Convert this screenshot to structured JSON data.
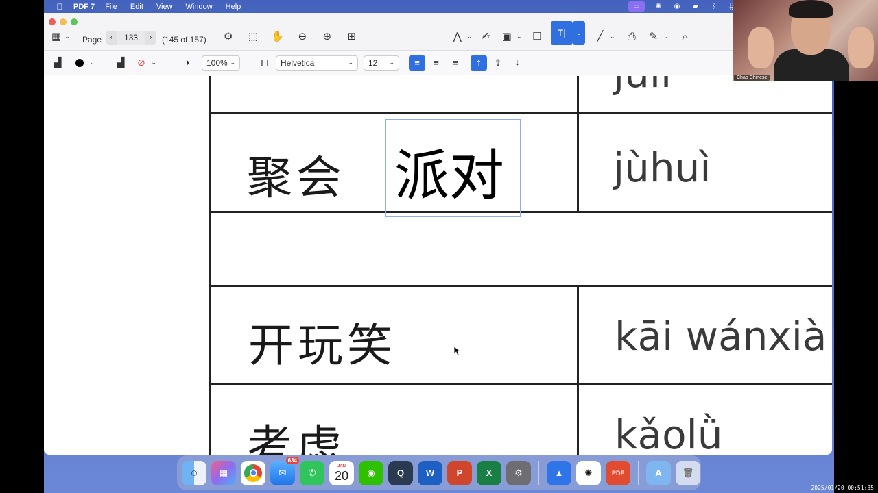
{
  "menubar": {
    "app_name": "PDF 7",
    "items": [
      "File",
      "Edit",
      "View",
      "Window",
      "Help"
    ]
  },
  "toolbar": {
    "page_label": "Page",
    "page_number": "133",
    "page_count": "(145 of 157)"
  },
  "format_bar": {
    "zoom": "100%",
    "font": "Helvetica",
    "font_size": "12"
  },
  "document": {
    "rows": [
      {
        "chinese": "聚会",
        "pinyin": "jùhuì",
        "note": "派对"
      },
      {
        "chinese": "开玩笑",
        "pinyin": "kāi wánxià"
      },
      {
        "chinese": "考虑",
        "pinyin": "kǎolǜ"
      }
    ],
    "top_partial_pinyin": "jūli"
  },
  "dock": {
    "mail_badge": "634",
    "calendar_month": "JAN",
    "calendar_day": "20",
    "pdf_label": "PDF"
  },
  "webcam": {
    "name": "Chao Chinese"
  },
  "timestamp": "2025/01/20 00:51:35"
}
